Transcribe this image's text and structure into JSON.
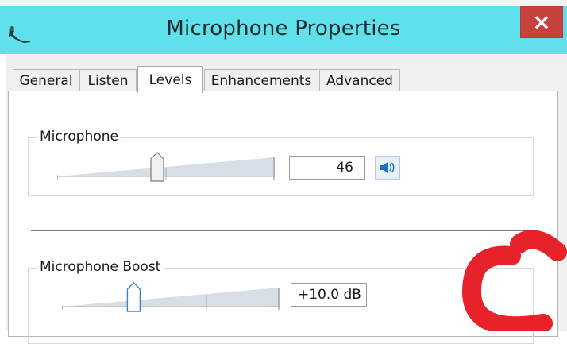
{
  "window": {
    "title": "Microphone Properties",
    "close_symbol": "×",
    "title_bar_color": "#5fe0ea",
    "close_button_color": "#c7423c"
  },
  "tabs": [
    {
      "label": "General",
      "active": false
    },
    {
      "label": "Listen",
      "active": false
    },
    {
      "label": "Levels",
      "active": true
    },
    {
      "label": "Enhancements",
      "active": false
    },
    {
      "label": "Advanced",
      "active": false
    }
  ],
  "levels": {
    "microphone": {
      "label": "Microphone",
      "value": "46",
      "level_percent": 46,
      "icon": "speaker-icon"
    },
    "boost": {
      "label": "Microphone Boost",
      "value": "+10.0 dB",
      "level_fraction": 0.33
    }
  },
  "watermark_color": "#e8222a"
}
